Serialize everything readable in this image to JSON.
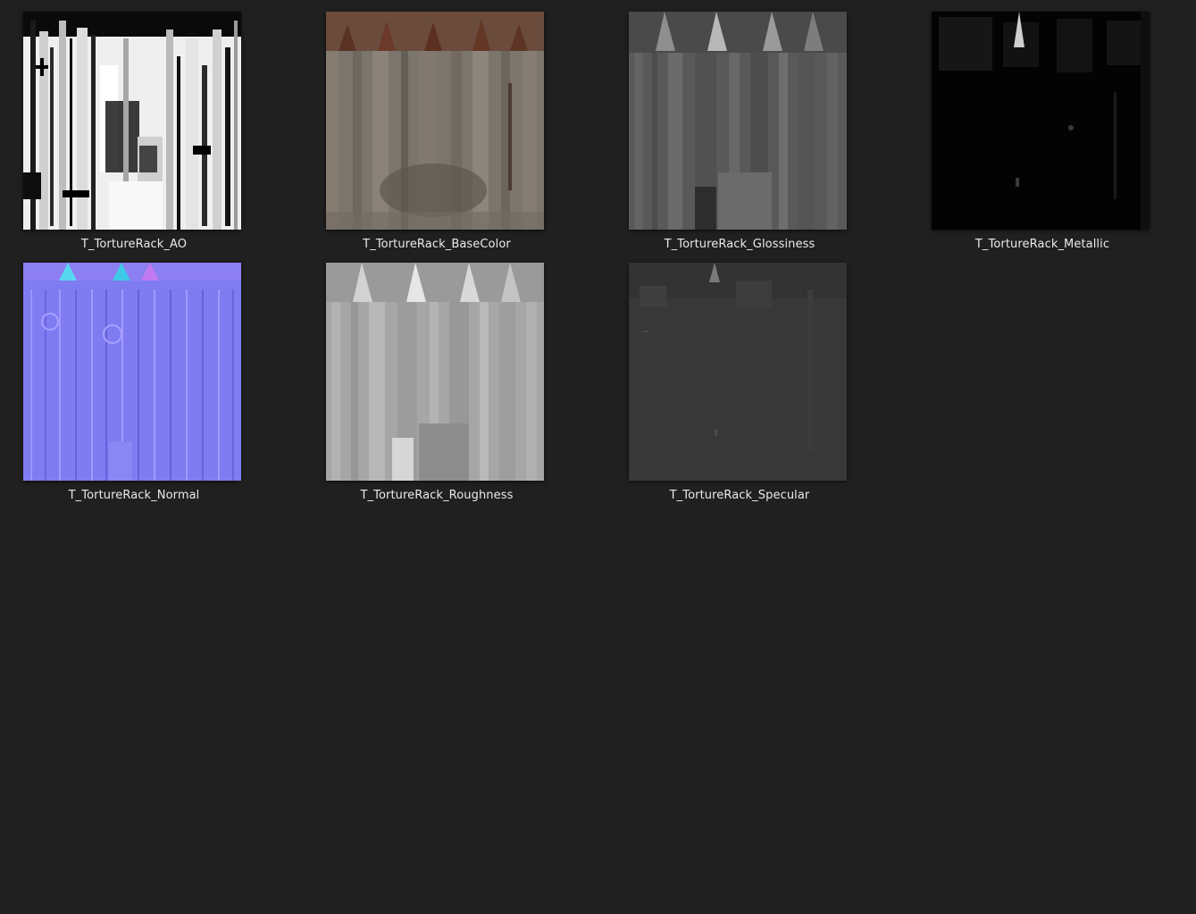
{
  "window": {
    "background": "#202020",
    "view_mode": "large-icons"
  },
  "files": [
    {
      "name": "T_TortureRack_AO",
      "texture": "ambient-occlusion",
      "thumb_color": "#f2f2f2"
    },
    {
      "name": "T_TortureRack_BaseColor",
      "texture": "base-color",
      "thumb_color": "#7c746a"
    },
    {
      "name": "T_TortureRack_Glossiness",
      "texture": "glossiness",
      "thumb_color": "#5a5a5a"
    },
    {
      "name": "T_TortureRack_Metallic",
      "texture": "metallic",
      "thumb_color": "#020202"
    },
    {
      "name": "T_TortureRack_Normal",
      "texture": "normal",
      "thumb_color": "#7f7cf5"
    },
    {
      "name": "T_TortureRack_Roughness",
      "texture": "roughness",
      "thumb_color": "#a9a9a9"
    },
    {
      "name": "T_TortureRack_Specular",
      "texture": "specular",
      "thumb_color": "#383838"
    }
  ]
}
